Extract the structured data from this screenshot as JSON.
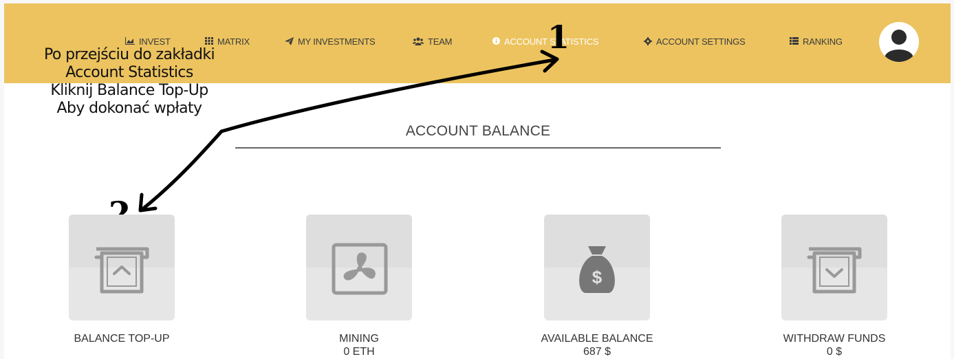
{
  "navbar": {
    "items": [
      {
        "label": "INVEST",
        "icon": "area-chart-icon"
      },
      {
        "label": "MATRIX",
        "icon": "grid-icon"
      },
      {
        "label": "MY INVESTMENTS",
        "icon": "paper-plane-icon"
      },
      {
        "label": "TEAM",
        "icon": "users-icon"
      },
      {
        "label": "ACCOUNT STATISTICS",
        "icon": "info-icon",
        "active": true
      },
      {
        "label": "ACCOUNT SETTINGS",
        "icon": "gear-icon"
      },
      {
        "label": "RANKING",
        "icon": "list-icon"
      }
    ],
    "avatar_icon": "user-avatar-icon",
    "background": "#ecc35f",
    "active_color": "#ffffff"
  },
  "annotation": {
    "lines": [
      "Po przejściu do zakładki",
      "Account Statistics",
      "Kliknij Balance Top-Up",
      "Aby dokonać wpłaty"
    ],
    "marker_1": "1",
    "marker_2": "2"
  },
  "section": {
    "title": "ACCOUNT BALANCE"
  },
  "tiles": [
    {
      "label": "BALANCE TOP-UP",
      "value": "",
      "icon": "atm-deposit-icon"
    },
    {
      "label": "MINING",
      "value": "0 ETH",
      "icon": "fan-icon"
    },
    {
      "label": "AVAILABLE BALANCE",
      "value": "687 $",
      "icon": "money-bag-icon"
    },
    {
      "label": "WITHDRAW FUNDS",
      "value": "0 $",
      "icon": "atm-withdraw-icon"
    }
  ]
}
